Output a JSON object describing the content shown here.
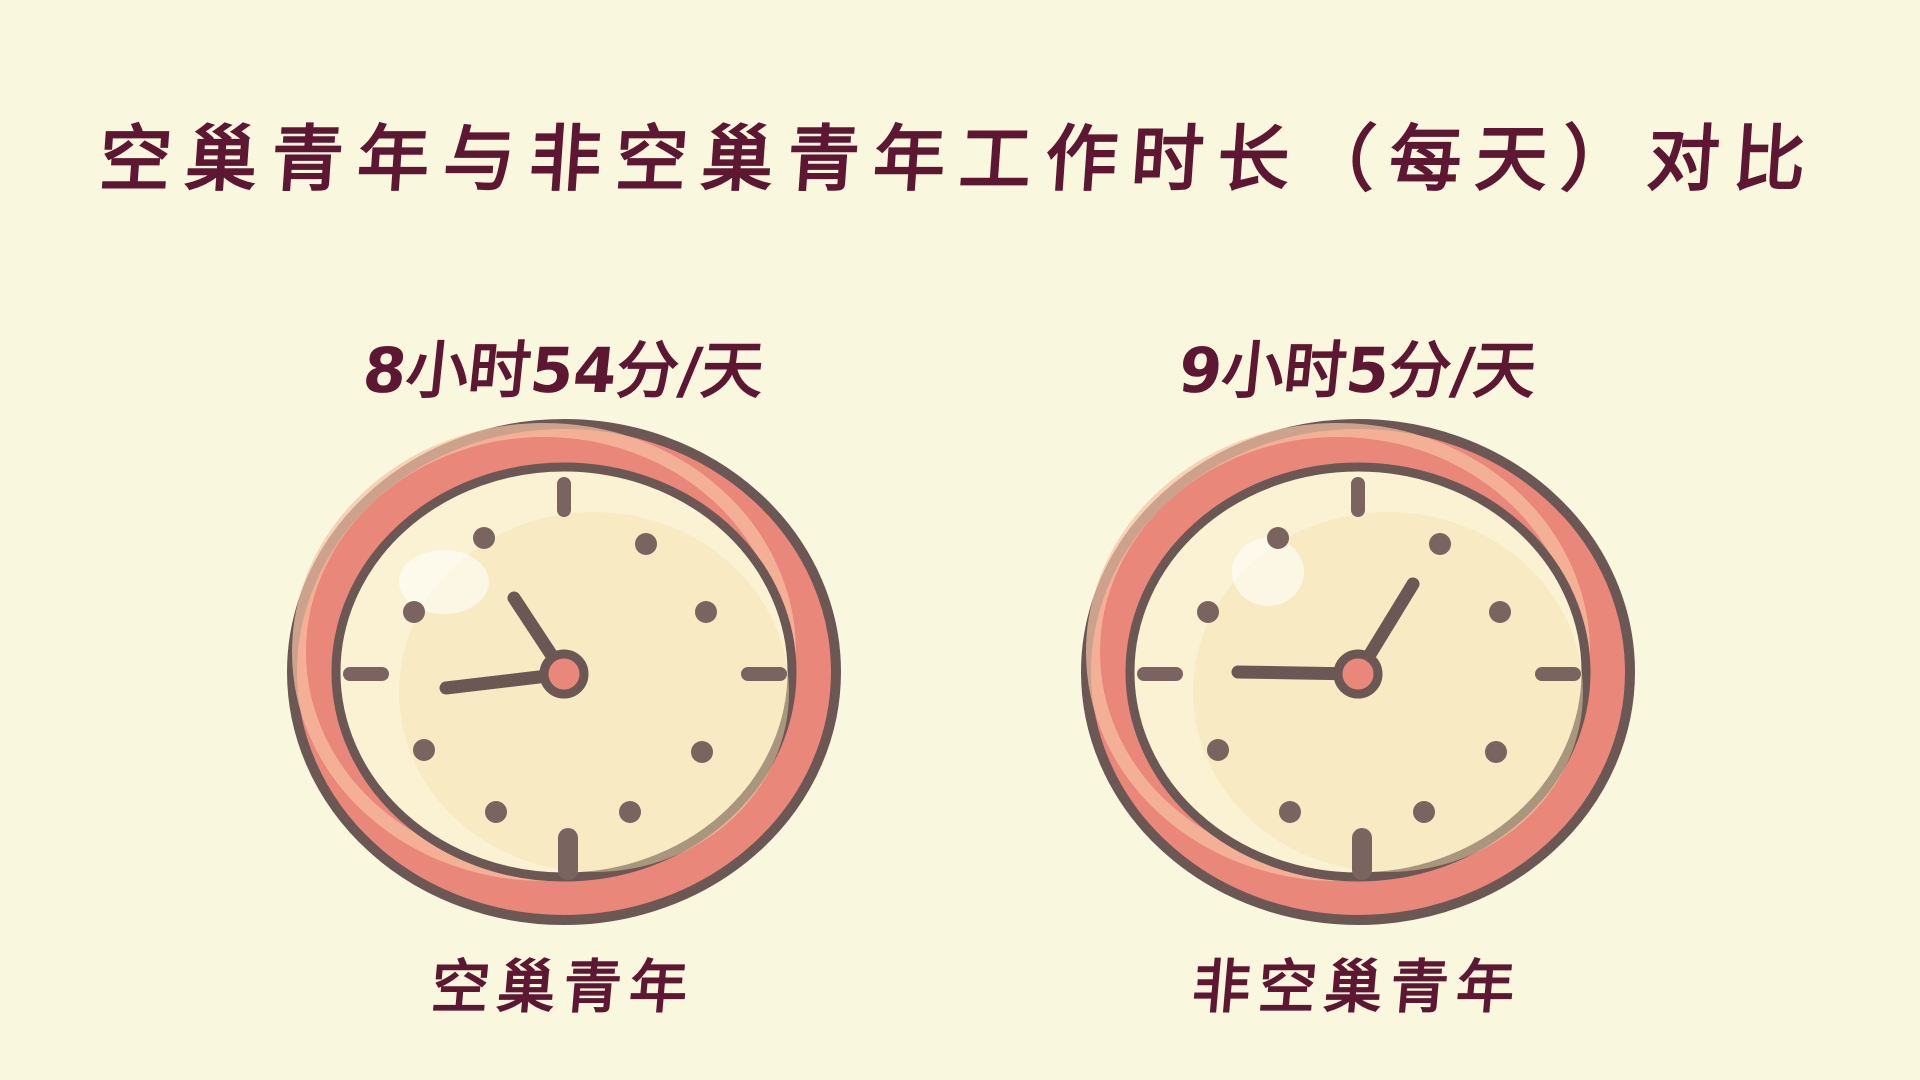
{
  "title": "空巢青年与非空巢青年工作时长（每天）对比",
  "colors": {
    "background": "#f9f7dd",
    "text": "#5e1732",
    "clock_rim": "#e9877a",
    "clock_outline": "#6b5854",
    "clock_face": "#fbf2d3",
    "tick": "#7a6460"
  },
  "clocks": [
    {
      "duration": "8小时54分/天",
      "group": "空巢青年",
      "hands": {
        "hour": 11,
        "minute": 45
      }
    },
    {
      "duration": "9小时5分/天",
      "group": "非空巢青年",
      "hands": {
        "hour": 1,
        "minute": 45
      }
    }
  ]
}
